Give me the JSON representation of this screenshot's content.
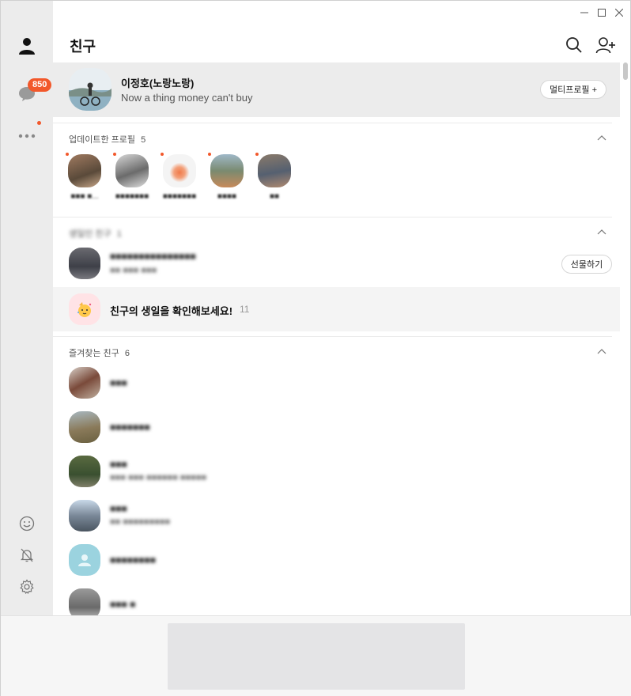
{
  "window": {
    "minimize_glyph": "—",
    "maximize_glyph": "☐",
    "close_glyph": "✕"
  },
  "rail": {
    "items": [
      {
        "name": "friends",
        "icon": "person-icon"
      },
      {
        "name": "chats",
        "icon": "chat-bubble-icon",
        "badge": "850"
      },
      {
        "name": "more",
        "icon": "more-dots-icon"
      }
    ],
    "bottom": [
      "emoticon-icon",
      "bell-off-icon",
      "gear-icon"
    ]
  },
  "header": {
    "title": "친구"
  },
  "my_profile": {
    "name": "이정호(노랑노랑)",
    "status": "Now a thing money can't buy",
    "multi_profile_label": "멀티프로필 +"
  },
  "updated_section": {
    "title": "업데이트한 프로필",
    "count": "5",
    "items": [
      {
        "name": "■■■ ■..."
      },
      {
        "name": "■■■■■■■"
      },
      {
        "name": "■■■■■■■"
      },
      {
        "name": "■■■■"
      },
      {
        "name": "■■"
      }
    ]
  },
  "birthday_section": {
    "title": "생일인 친구",
    "count": "1",
    "friend_name": "■■■■■■■■■■■■■■■",
    "friend_sub": "■■ ■■■ ■■■",
    "gift_label": "선물하기",
    "check_text": "친구의 생일을 확인해보세요!",
    "check_count": "11"
  },
  "favorites_section": {
    "title": "즐겨찾는 친구",
    "count": "6",
    "items": [
      {
        "name": "■■■",
        "sub": ""
      },
      {
        "name": "■■■■■■■",
        "sub": ""
      },
      {
        "name": "■■■",
        "sub": "■■■ ■■■ ■■■■■■ ■■■■■"
      },
      {
        "name": "■■■",
        "sub": "■■ ■■■■■■■■■"
      },
      {
        "name": "■■■■■■■■",
        "sub": ""
      },
      {
        "name": "■■■ ■",
        "sub": ""
      }
    ]
  },
  "colors": {
    "accent": "#f2582b",
    "rail_bg": "#ececec",
    "selected_bg": "#ececec"
  }
}
